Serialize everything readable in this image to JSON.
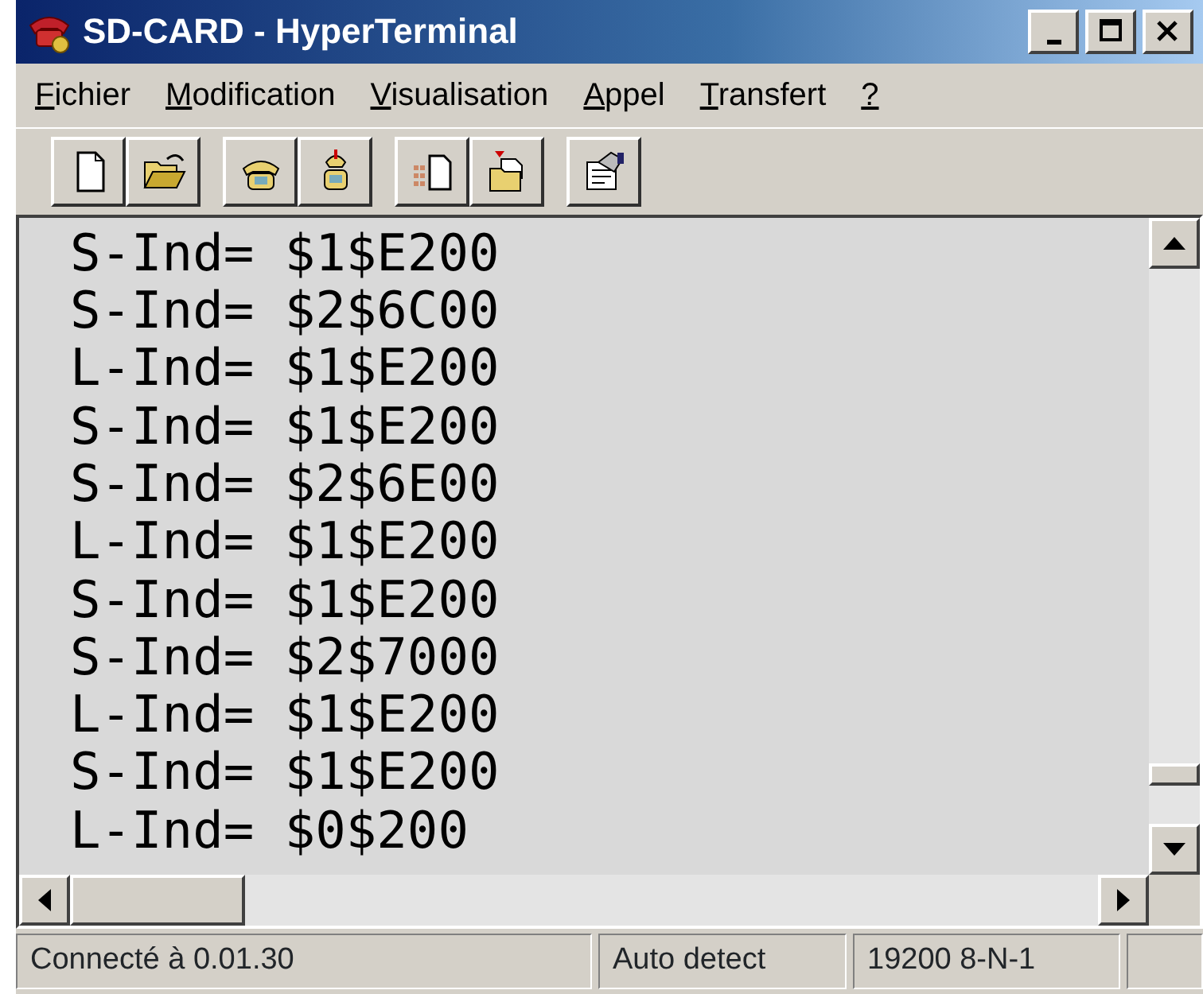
{
  "window": {
    "title": "SD-CARD - HyperTerminal"
  },
  "menu": [
    "Fichier",
    "Modification",
    "Visualisation",
    "Appel",
    "Transfert",
    "?"
  ],
  "terminal": {
    "lines": [
      "S-Ind= $1$E200",
      "S-Ind= $2$6C00",
      "L-Ind= $1$E200",
      "S-Ind= $1$E200",
      "S-Ind= $2$6E00",
      "L-Ind= $1$E200",
      "S-Ind= $1$E200",
      "S-Ind= $2$7000",
      "L-Ind= $1$E200",
      "S-Ind= $1$E200",
      "L-Ind= $0$200"
    ]
  },
  "status_bar": [
    "Connecté à 0.01.30",
    "Auto detect",
    "19200 8-N-1"
  ]
}
